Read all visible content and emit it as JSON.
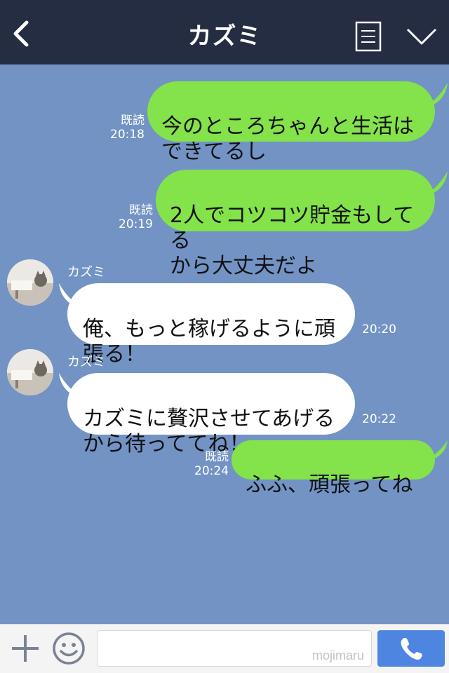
{
  "header": {
    "title": "カズミ",
    "icons": [
      "back-chevron-icon",
      "menu-list-icon",
      "chevron-down-icon"
    ]
  },
  "messages": [
    {
      "side": "me",
      "text": "今のところちゃんと生活は\nできてるし",
      "read": "既読",
      "time": "20:18"
    },
    {
      "side": "me",
      "text": "2人でコツコツ貯金もしてる\nから大丈夫だよ",
      "read": "既読",
      "time": "20:19"
    },
    {
      "side": "them",
      "sender": "カズミ",
      "text": "俺、もっと稼げるように頑\n張る！",
      "time": "20:20"
    },
    {
      "side": "them",
      "sender": "カズミ",
      "text": "カズミに贅沢させてあげる\nから待っててね！",
      "time": "20:22"
    },
    {
      "side": "me",
      "text": "ふふ、頑張ってね",
      "read": "既読",
      "time": "20:24"
    }
  ],
  "footer": {
    "input_value": "",
    "watermark": "mojimaru",
    "icons": [
      "plus-icon",
      "smile-icon",
      "phone-icon"
    ]
  },
  "colors": {
    "header_bg": "#242d41",
    "chat_bg": "#7293c4",
    "my_bubble": "#84e24a",
    "their_bubble": "#ffffff",
    "call_button": "#4e85e1"
  }
}
